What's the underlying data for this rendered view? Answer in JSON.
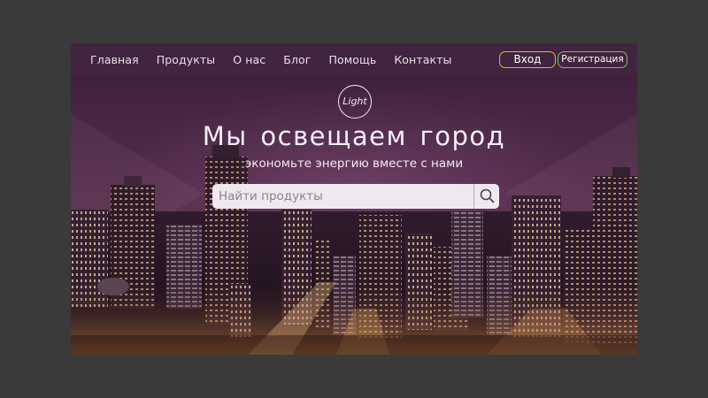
{
  "nav": {
    "links": [
      "Главная",
      "Продукты",
      "О нас",
      "Блог",
      "Помощь",
      "Контакты"
    ],
    "login": "Вход",
    "register": "Регистрация"
  },
  "hero": {
    "logo_text": "Light",
    "headline": "Мы освещаем город",
    "subline": "экономьте энергию вместе с нами"
  },
  "search": {
    "placeholder": "Найти продукты",
    "value": "",
    "icon": "search-icon"
  },
  "colors": {
    "login_border": "#e8b23a",
    "register_border": "#6cc65c",
    "page_background": "#3a3a3a"
  }
}
